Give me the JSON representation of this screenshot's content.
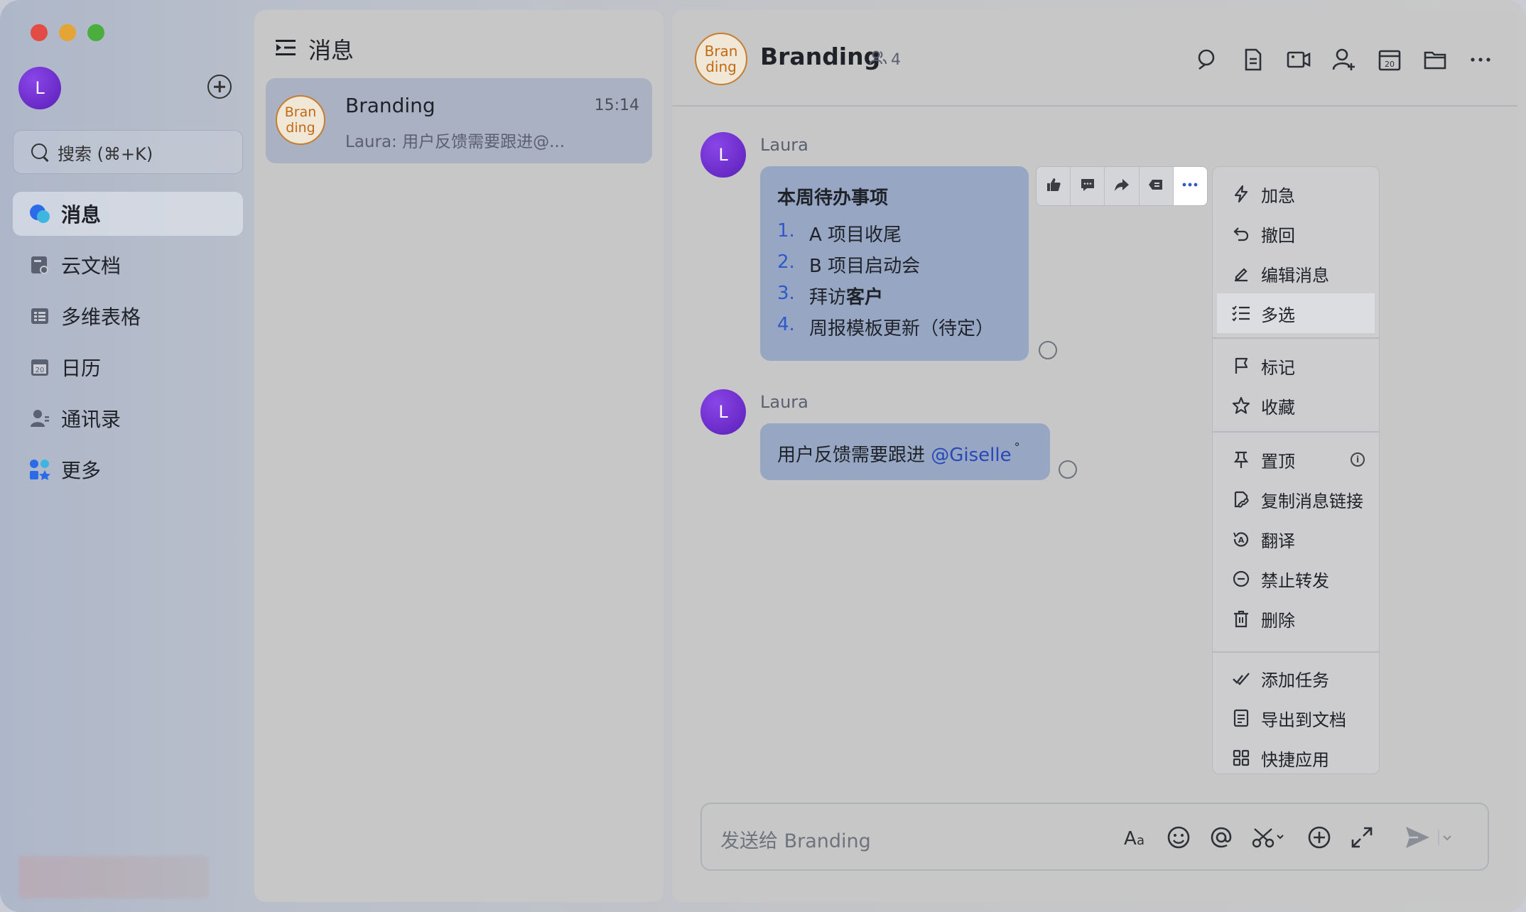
{
  "sidebar": {
    "user_initial": "L",
    "search_placeholder": "搜索 (⌘+K)",
    "items": [
      {
        "label": "消息",
        "icon": "chat-bubble-icon"
      },
      {
        "label": "云文档",
        "icon": "cloud-doc-icon"
      },
      {
        "label": "多维表格",
        "icon": "base-table-icon"
      },
      {
        "label": "日历",
        "icon": "calendar-icon"
      },
      {
        "label": "通讯录",
        "icon": "contacts-icon"
      },
      {
        "label": "更多",
        "icon": "more-apps-icon"
      }
    ]
  },
  "conversations": {
    "title": "消息",
    "items": [
      {
        "avatar_text": "Bran ding",
        "name": "Branding",
        "time": "15:14",
        "preview": "Laura: 用户反馈需要跟进@..."
      }
    ]
  },
  "chat": {
    "avatar_text": "Bran ding",
    "title": "Branding",
    "member_count": "4",
    "messages": [
      {
        "sender": "Laura",
        "initial": "L",
        "title": "本周待办事项",
        "todo": [
          {
            "num": "1.",
            "text": "A 项目收尾"
          },
          {
            "num": "2.",
            "text": "B 项目启动会"
          },
          {
            "num": "3.",
            "text_plain": "拜访",
            "text_bold": "客户"
          },
          {
            "num": "4.",
            "text": "周报模板更新（待定）"
          }
        ]
      },
      {
        "sender": "Laura",
        "initial": "L",
        "text": "用户反馈需要跟进 ",
        "mention": "@Giselle"
      }
    ],
    "input_placeholder": "发送给 Branding"
  },
  "context_menu": {
    "groups": [
      [
        {
          "label": "加急",
          "icon": "lightning-icon"
        },
        {
          "label": "撤回",
          "icon": "undo-icon"
        },
        {
          "label": "编辑消息",
          "icon": "edit-icon"
        },
        {
          "label": "多选",
          "icon": "multi-select-icon",
          "highlighted": true
        }
      ],
      [
        {
          "label": "标记",
          "icon": "flag-icon"
        },
        {
          "label": "收藏",
          "icon": "star-icon"
        }
      ],
      [
        {
          "label": "置顶",
          "icon": "pin-icon",
          "info": "i"
        },
        {
          "label": "复制消息链接",
          "icon": "link-icon"
        },
        {
          "label": "翻译",
          "icon": "translate-icon"
        },
        {
          "label": "禁止转发",
          "icon": "no-forward-icon"
        },
        {
          "label": "删除",
          "icon": "trash-icon"
        }
      ],
      [
        {
          "label": "添加任务",
          "icon": "task-check-icon"
        },
        {
          "label": "导出到文档",
          "icon": "export-doc-icon"
        },
        {
          "label": "快捷应用",
          "icon": "apps-grid-icon"
        }
      ]
    ]
  },
  "colors": {
    "accent": "#2f58c8",
    "bubble": "#97a6c3",
    "avatar_purple": "#6a2fd0",
    "brand_orange": "#c26a12"
  }
}
